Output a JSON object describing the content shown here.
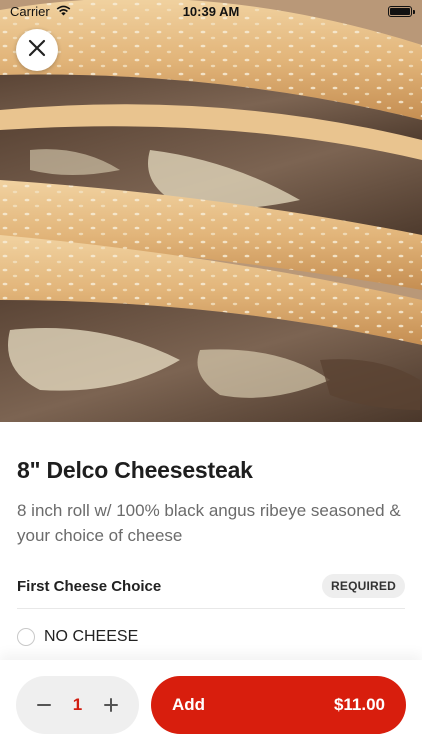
{
  "status_bar": {
    "carrier": "Carrier",
    "time": "10:39 AM"
  },
  "item": {
    "title": "8\" Delco Cheesesteak",
    "description": "8 inch roll w/ 100% black angus ribeye seasoned & your choice of cheese"
  },
  "options_section": {
    "title": "First Cheese Choice",
    "badge": "REQUIRED",
    "options": [
      {
        "label": "NO CHEESE",
        "selected": false
      }
    ]
  },
  "cart": {
    "quantity": "1",
    "add_label": "Add",
    "price": "$11.00"
  },
  "colors": {
    "accent": "#d81e0d",
    "quantity_text": "#d01d10"
  },
  "icons": {
    "close": "close-icon",
    "minus": "minus-icon",
    "plus": "plus-icon",
    "wifi": "wifi-icon",
    "battery": "battery-icon"
  }
}
